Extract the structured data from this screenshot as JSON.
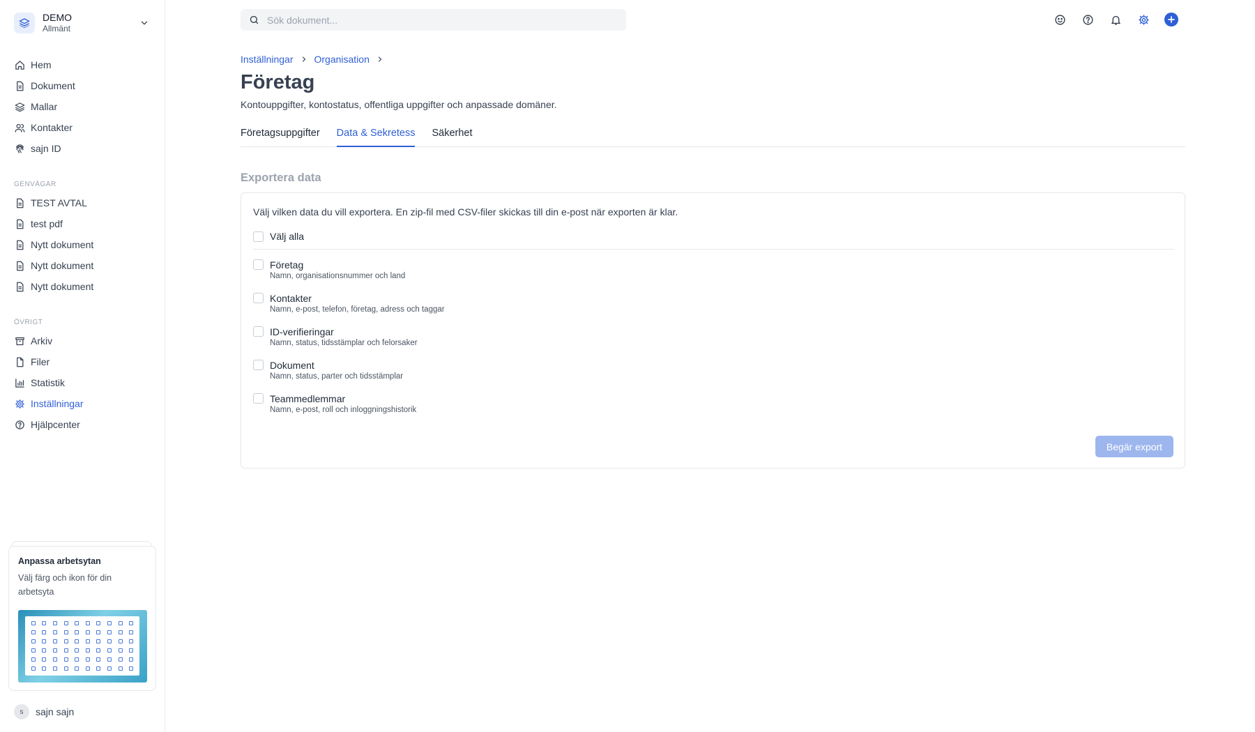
{
  "workspace": {
    "name": "DEMO",
    "subtitle": "Allmänt"
  },
  "nav": [
    {
      "label": "Hem",
      "icon": "home-icon"
    },
    {
      "label": "Dokument",
      "icon": "document-icon"
    },
    {
      "label": "Mallar",
      "icon": "layers-icon"
    },
    {
      "label": "Kontakter",
      "icon": "users-icon"
    },
    {
      "label": "sajn ID",
      "icon": "fingerprint-icon"
    }
  ],
  "shortcuts": {
    "label": "GENVÄGAR",
    "items": [
      {
        "label": "TEST AVTAL"
      },
      {
        "label": "test pdf"
      },
      {
        "label": "Nytt dokument"
      },
      {
        "label": "Nytt dokument"
      },
      {
        "label": "Nytt dokument"
      }
    ]
  },
  "other": {
    "label": "ÖVRIGT",
    "items": [
      {
        "label": "Arkiv",
        "icon": "archive-icon"
      },
      {
        "label": "Filer",
        "icon": "file-icon"
      },
      {
        "label": "Statistik",
        "icon": "bar-chart-icon"
      },
      {
        "label": "Inställningar",
        "icon": "gear-icon",
        "active": true
      },
      {
        "label": "Hjälpcenter",
        "icon": "help-circle-icon"
      }
    ]
  },
  "promo": {
    "title": "Anpassa arbetsytan",
    "description": "Välj färg och ikon för din arbetsyta"
  },
  "user": {
    "initial": "s",
    "name": "sajn sajn"
  },
  "search": {
    "placeholder": "Sök dokument..."
  },
  "top_icons": [
    "smiley-icon",
    "help-circle-icon",
    "bell-icon",
    "gear-icon",
    "plus-circle-icon"
  ],
  "breadcrumb": [
    "Inställningar",
    "Organisation"
  ],
  "page": {
    "title": "Företag",
    "subtitle": "Kontouppgifter, kontostatus, offentliga uppgifter och anpassade domäner."
  },
  "tabs": [
    {
      "label": "Företagsuppgifter",
      "active": false
    },
    {
      "label": "Data & Sekretess",
      "active": true
    },
    {
      "label": "Säkerhet",
      "active": false
    }
  ],
  "export": {
    "section_title": "Exportera data",
    "description": "Välj vilken data du vill exportera. En zip-fil med CSV-filer skickas till din e-post när exporten är klar.",
    "select_all": "Välj alla",
    "options": [
      {
        "label": "Företag",
        "description": "Namn, organisationsnummer och land"
      },
      {
        "label": "Kontakter",
        "description": "Namn, e-post, telefon, företag, adress och taggar"
      },
      {
        "label": "ID-verifieringar",
        "description": "Namn, status, tidsstämplar och felorsaker"
      },
      {
        "label": "Dokument",
        "description": "Namn, status, parter och tidsstämplar"
      },
      {
        "label": "Teammedlemmar",
        "description": "Namn, e-post, roll och inloggningshistorik"
      }
    ],
    "button": "Begär export"
  },
  "colors": {
    "accent": "#2f5fd6",
    "button_disabled": "#9db6ee",
    "border": "#e5e7eb"
  }
}
